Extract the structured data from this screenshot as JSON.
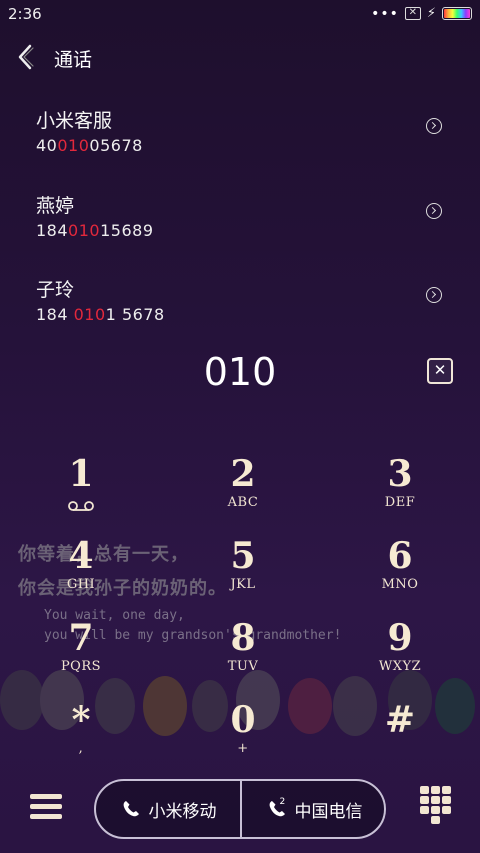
{
  "status": {
    "time": "2:36",
    "dots": "•••"
  },
  "header": {
    "title": "通话"
  },
  "contacts": [
    {
      "name": "小米客服",
      "number_pre": "40",
      "number_match": "010",
      "number_post": "05678"
    },
    {
      "name": "燕婷",
      "number_pre": "184",
      "number_match": "010",
      "number_post": "15689"
    },
    {
      "name": "子玲",
      "number_pre": "184 ",
      "number_match": "010",
      "number_post": "1 5678"
    }
  ],
  "dial_input": "010",
  "clear_label": "✕",
  "keys": [
    {
      "digit": "1",
      "letters": ""
    },
    {
      "digit": "2",
      "letters": "ABC"
    },
    {
      "digit": "3",
      "letters": "DEF"
    },
    {
      "digit": "4",
      "letters": "GHI"
    },
    {
      "digit": "5",
      "letters": "JKL"
    },
    {
      "digit": "6",
      "letters": "MNO"
    },
    {
      "digit": "7",
      "letters": "PQRS"
    },
    {
      "digit": "8",
      "letters": "TUV"
    },
    {
      "digit": "9",
      "letters": "WXYZ"
    },
    {
      "digit": "*",
      "letters": ","
    },
    {
      "digit": "0",
      "letters": "+"
    },
    {
      "digit": "#",
      "letters": ""
    }
  ],
  "watermark": {
    "line1": "你等着，总有一天，",
    "line2": "你会是我孙子的奶奶的。",
    "line3": "You wait, one day,",
    "line4": "you will be my grandson's grandmother!"
  },
  "bottom": {
    "sim1_label": "小米移动",
    "sim2_label": "中国电信",
    "sim2_badge": "2"
  },
  "colors": {
    "background": "#25123a",
    "highlight": "#e2283c",
    "key_text": "#f6ead2"
  },
  "icons": {
    "back": "chevron-left-icon",
    "detail": "chevron-right-circle-icon",
    "voicemail": "voicemail-icon",
    "menu": "hamburger-icon",
    "phone": "phone-icon",
    "dialpad": "dialpad-icon"
  }
}
